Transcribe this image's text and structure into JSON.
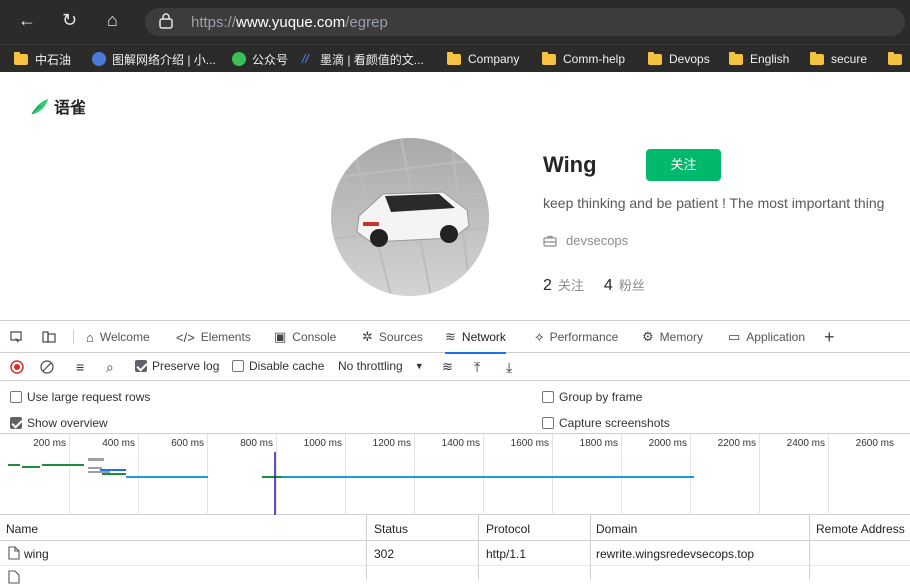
{
  "browser": {
    "url_host": "https://www.yuque.com",
    "url_path": "/egrep",
    "url_scheme": "https://",
    "url_domain": "www.yuque.com"
  },
  "bookmarks": [
    {
      "label": "中石油",
      "icon": "folder-icon"
    },
    {
      "label": "图解网络介绍 | 小...",
      "icon": "site-icon"
    },
    {
      "label": "公众号",
      "icon": "site-icon"
    },
    {
      "label": "墨滴 | 看颜值的文...",
      "icon": "site-icon"
    },
    {
      "label": "Company",
      "icon": "folder-icon"
    },
    {
      "label": "Comm-help",
      "icon": "folder-icon"
    },
    {
      "label": "Devops",
      "icon": "folder-icon"
    },
    {
      "label": "English",
      "icon": "folder-icon"
    },
    {
      "label": "secure",
      "icon": "folder-icon"
    }
  ],
  "site": {
    "logo_text": "语雀"
  },
  "profile": {
    "name": "Wing",
    "follow_label": "关注",
    "bio": "keep thinking and be patient ! The most important thing",
    "org": "devsecops",
    "following_count": "2",
    "following_label": "关注",
    "followers_count": "4",
    "followers_label": "粉丝"
  },
  "devtools": {
    "tabs": [
      {
        "label": "Welcome",
        "icon": "home-icon"
      },
      {
        "label": "Elements",
        "icon": "code-icon"
      },
      {
        "label": "Console",
        "icon": "console-icon"
      },
      {
        "label": "Sources",
        "icon": "bug-icon"
      },
      {
        "label": "Network",
        "icon": "wifi-icon",
        "active": true
      },
      {
        "label": "Performance",
        "icon": "performance-icon"
      },
      {
        "label": "Memory",
        "icon": "chip-icon"
      },
      {
        "label": "Application",
        "icon": "window-icon"
      }
    ],
    "toolbar": {
      "preserve_log": "Preserve log",
      "disable_cache": "Disable cache",
      "throttling": "No throttling"
    },
    "options": {
      "large_rows": "Use large request rows",
      "group_by_frame": "Group by frame",
      "show_overview": "Show overview",
      "capture_screenshots": "Capture screenshots"
    },
    "timeline_ticks": [
      "200 ms",
      "400 ms",
      "600 ms",
      "800 ms",
      "1000 ms",
      "1200 ms",
      "1400 ms",
      "1600 ms",
      "1800 ms",
      "2000 ms",
      "2200 ms",
      "2400 ms",
      "2600 ms"
    ],
    "table": {
      "columns": [
        "Name",
        "Status",
        "Protocol",
        "Domain",
        "Remote Address"
      ],
      "rows": [
        {
          "name": "wing",
          "status": "302",
          "protocol": "http/1.1",
          "domain": "rewrite.wingsredevsecops.top",
          "remote": ""
        }
      ]
    }
  },
  "colors": {
    "accent_green": "#00b96b",
    "devtools_blue": "#1a73e8",
    "chrome_dark": "#2b2b2b"
  }
}
